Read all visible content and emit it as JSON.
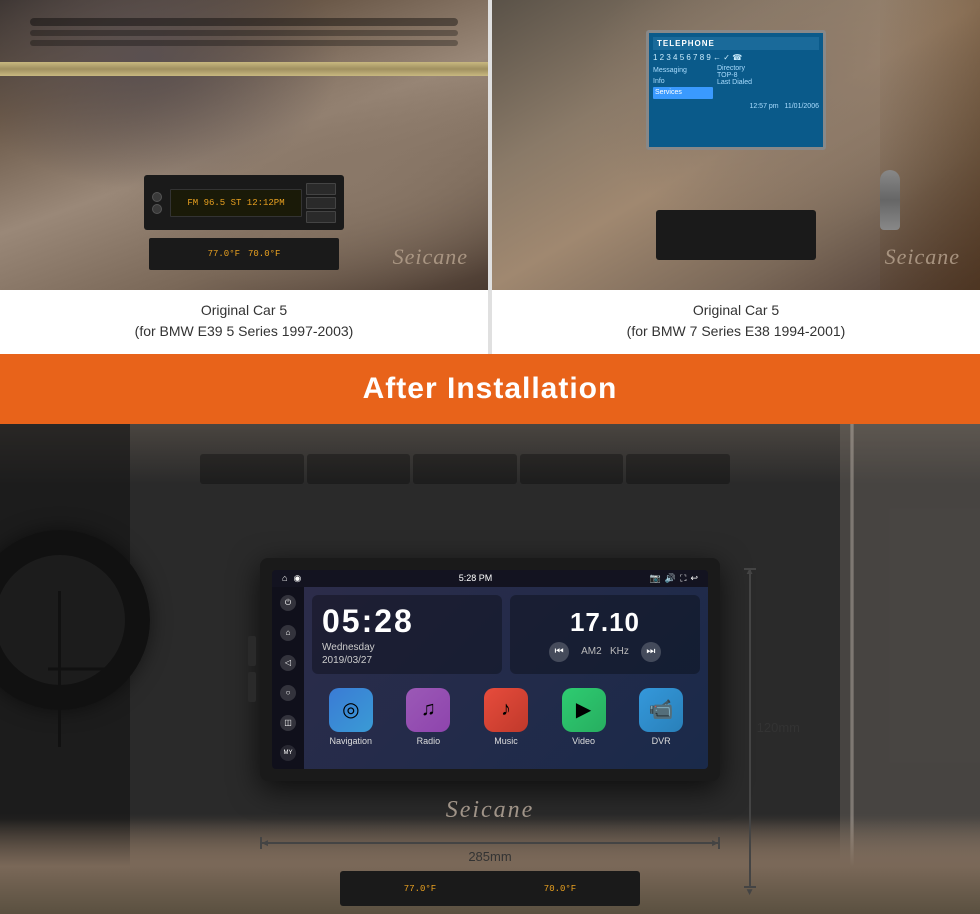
{
  "brand": {
    "watermark": "Seicane",
    "watermark_after": "Seicane"
  },
  "top_section": {
    "car1": {
      "caption_line1": "Original Car 5",
      "caption_line2": "(for BMW E39 5 Series 1997-2003)",
      "radio_display": "FM  96.5 ST    12:12PM"
    },
    "car2": {
      "caption_line1": "Original Car 5",
      "caption_line2": "(for BMW 7 Series E38 1994-2001)",
      "phone_header": "TELEPHONE",
      "phone_menu_items": [
        "Messaging",
        "Info",
        ""
      ],
      "phone_right_items": [
        "Directory",
        "TOP-8",
        "Last Dialed"
      ]
    }
  },
  "banner": {
    "title": "After Installation"
  },
  "after_section": {
    "screen": {
      "status_bar": {
        "home_icon": "⌂",
        "gps_icon": "◉",
        "time": "5:28 PM",
        "camera_icon": "📷",
        "volume_icon": "🔊",
        "fullscreen_icon": "⛶",
        "back_icon": "↩"
      },
      "side_icons": [
        "⏻",
        "⌂",
        "◁",
        "○",
        "◫",
        "MY"
      ],
      "clock": {
        "time": "05:28",
        "day": "Wednesday",
        "date": "2019/03/27"
      },
      "radio": {
        "freq": "17.10",
        "band": "AM2",
        "unit": "KHz"
      },
      "apps": [
        {
          "label": "Navigation",
          "icon": "◎"
        },
        {
          "label": "Radio",
          "icon": "♫"
        },
        {
          "label": "Music",
          "icon": "♪"
        },
        {
          "label": "Video",
          "icon": "▶"
        },
        {
          "label": "DVR",
          "icon": "📹"
        }
      ]
    },
    "dimensions": {
      "width": "285mm",
      "height": "120mm"
    }
  }
}
